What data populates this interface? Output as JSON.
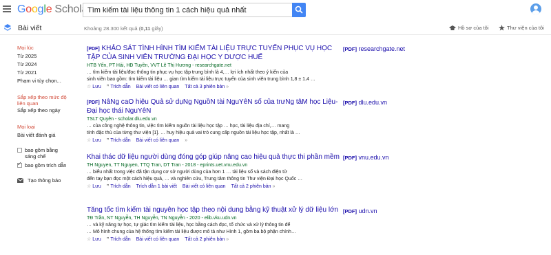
{
  "header": {
    "logo_google": [
      "G",
      "o",
      "o",
      "g",
      "l",
      "e"
    ],
    "logo_scholar": "Scholar",
    "search_value": "Tìm kiếm tài liệu thông tin 1 cách hiệu quả nhất"
  },
  "subheader": {
    "articles_label": "Bài viết",
    "result_count_prefix": "Khoảng 28.300 kết quả (",
    "result_time": "0,11",
    "result_count_suffix": " giây)",
    "my_profile": "Hồ sơ của tôi",
    "my_library": "Thư viện của tôi"
  },
  "sidebar": {
    "any_time": "Mọi lúc",
    "since_2025": "Từ 2025",
    "since_2024": "Từ 2024",
    "since_2021": "Từ 2021",
    "custom_range": "Phạm vi tùy chọn...",
    "sort_relevance_1": "Sắp xếp theo mức độ",
    "sort_relevance_2": "liên quan",
    "sort_date": "Sắp xếp theo ngày",
    "any_type": "Mọi loại",
    "review_articles": "Bài viết đánh giá",
    "include_patents_1": "bao gồm bằng",
    "include_patents_2": "sáng chế",
    "include_citations": "bao gồm trích dẫn",
    "create_alert": "Tạo thông báo"
  },
  "results": [
    {
      "tag": "[PDF]",
      "title": "KHẢO SÁT TÌNH HÌNH TÌM KIẾM TÀI LIỆU TRỰC TUYẾN PHỤC VỤ HỌC TẬP CỦA SINH VIÊN TRƯỜNG ĐẠI HỌC Y DƯỢC HUẾ",
      "authors": "HTB Yến, PT Hải, HĐ Tuyền, VVT Lê Thị Hương - researchgate.net",
      "snippet_1": "… tìm kiếm tài liệu/đọc thông tin phục vụ học tập trung bình là 4,… lợi ích nhất theo ý kiến của",
      "snippet_2": "sinh viên bao gồm: tìm kiếm tài liệu … gian tìm kiếm tài liệu trực tuyến của sinh viên trung bình 1,8 ± 1,4 …",
      "save": "Lưu",
      "cite": "Trích dẫn",
      "related": "Bài viết có liên quan",
      "versions": "Tất cả 3 phiên bản",
      "side_pdf": "[PDF]",
      "side_domain": "researchgate.net"
    },
    {
      "tag": "[PDF]",
      "title": "NâNg caO hiệu Quả sử dụNg NguồN tài NguYêN số của trưNg tâM học Liệu-Đại học thái NguYêN",
      "authors": "TSLT Quyên - scholar.dlu.edu.vn",
      "snippet_1": "… của công nghệ thông tin, việc tìm kiếm nguồn tài liệu học tập … học, tài liệu địa chí,… mang",
      "snippet_2": "tính đặc thù của từng thư viện [1]. … huy hiệu quả vai trò cung cấp nguồn tài liệu học tập, nhất là …",
      "save": "Lưu",
      "cite": "Trích dẫn",
      "related": "Bài viết có liên quan",
      "versions": "",
      "side_pdf": "[PDF]",
      "side_domain": "dlu.edu.vn"
    },
    {
      "tag": "",
      "title": "Khai thác dữ liệu người dùng đóng góp giúp nâng cao hiệu quả thực thi phần mềm",
      "authors": "TH Nguyen, TT Nguyen, TTQ Tran, DT Tran - 2018 - eprints.uet.vnu.edu.vn",
      "snippet_1": "… biểu nhất trong việc đã tận dụng cơ sở người dùng của hơn 1 … tài liệu số và sách điện tử",
      "snippet_2": "đến tay bạn đọc một cách hiệu quả, … và nghiên cứu, Trung tâm thông tin Thư viện Đại học Quốc …",
      "save": "Lưu",
      "cite": "Trích dẫn",
      "cited_by": "Trích dẫn 1 bài viết",
      "related": "Bài viết có liên quan",
      "versions": "Tất cả 2 phiên bản",
      "side_pdf": "[PDF]",
      "side_domain": "vnu.edu.vn"
    },
    {
      "tag": "",
      "title": "Tăng tốc tìm kiếm tài nguyên học tập theo nội dung bằng kỹ thuật xử lý dữ liệu lớn",
      "authors": "TĐ Trần, NT Nguyễn, TH Nguyễn, TN Nguyễn - 2020 - elib.vku.udn.vn",
      "snippet_1": "… và kỹ năng tự học, tự giác tìm kiếm tài liệu, học bằng cách đọc, tổ chức và xử lý thông tin để",
      "snippet_2": "… Mô hình chung của hệ thống tìm kiếm tài liệu được mô tả như Hình 1, gồm ba bộ phận chính…",
      "save": "Lưu",
      "cite": "Trích dẫn",
      "related": "Bài viết có liên quan",
      "versions": "Tất cả 2 phiên bản",
      "side_pdf": "[PDF]",
      "side_domain": "udn.vn"
    }
  ],
  "colors": {
    "link": "#1a0dab",
    "author_green": "#006621",
    "accent_blue": "#4285f4",
    "sidebar_red": "#d14836"
  }
}
